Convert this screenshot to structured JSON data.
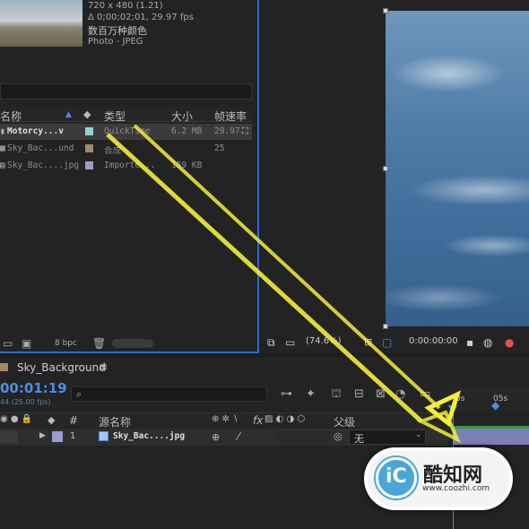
{
  "project": {
    "thumbnail_info": {
      "dimensions": "720 x 480 (1.21)",
      "duration": "Δ 0;00;02;01, 29.97 fps",
      "color_label": "数百万种颜色",
      "type_label": "Photo - JPEG"
    },
    "columns": [
      "名称",
      "类型",
      "大小",
      "帧速率"
    ],
    "rows": [
      {
        "name": "Motorcy...v",
        "type": "QuickTime",
        "size": "6.2 MB",
        "fps": "29.97",
        "swatch": "#8fd3d3"
      },
      {
        "name": "Sky_Bac...und",
        "type": "合成",
        "size": "",
        "fps": "25",
        "swatch": "#a08a6a"
      },
      {
        "name": "Sky_Bac....jpg",
        "type": "Importe...",
        "size": "159 KB",
        "fps": "",
        "swatch": "#9c9cd0"
      }
    ],
    "footer": {
      "bpc": "8 bpc"
    }
  },
  "viewer": {
    "zoom": "(74.6%)",
    "timecode": "0:00:00:00"
  },
  "timeline": {
    "comp_name": "Sky_Background",
    "timecode": "00:01:19",
    "fps_note": "44 (25.00 fps)",
    "search_placeholder": "",
    "columns": {
      "source_name": "源名称",
      "parent": "父级",
      "fx": "fx"
    },
    "layer": {
      "index": "1",
      "name": "Sky_Bac....jpg",
      "parent": "无",
      "label_color": "#9c9cd0"
    },
    "ruler": {
      "marks": [
        "0s",
        "05s"
      ]
    }
  },
  "watermark": {
    "title": "酷知网",
    "url": "www.coozhi.com"
  },
  "colors": {
    "accent": "#2d6bd6",
    "arrow": "#f2ee3a",
    "timecode": "#4a8ee8",
    "track": "#7b7fb8"
  }
}
